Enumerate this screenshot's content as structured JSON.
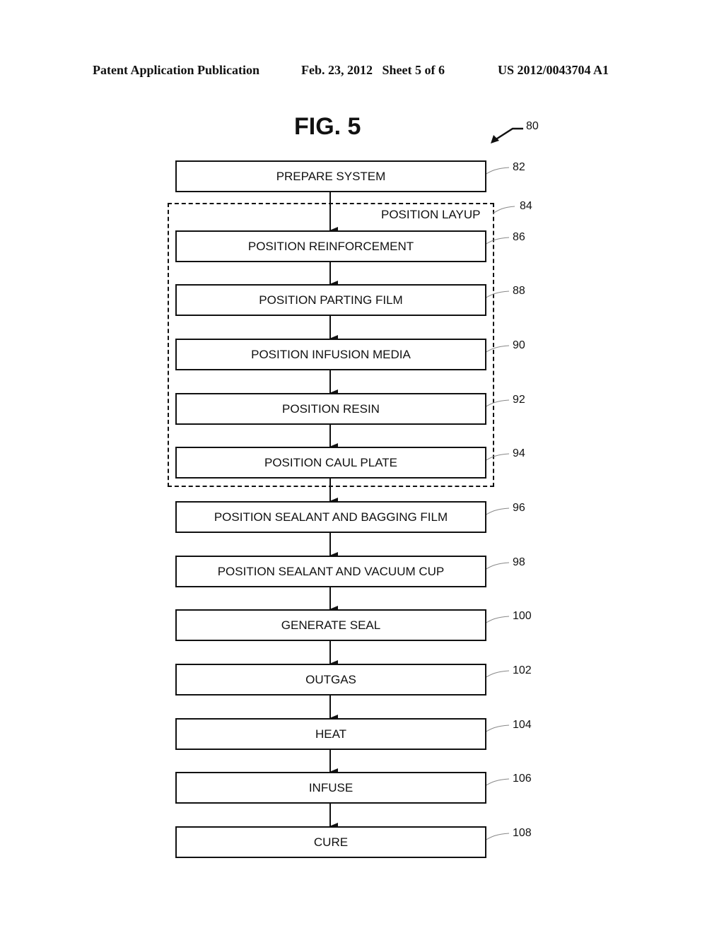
{
  "header": {
    "publication": "Patent Application Publication",
    "date_sheet": "Feb. 23, 2012   Sheet 5 of 6",
    "number": "US 2012/0043704 A1"
  },
  "figure": {
    "title": "FIG. 5",
    "ref": "80",
    "group": {
      "label": "POSITION LAYUP",
      "ref": "84"
    },
    "steps": [
      {
        "label": "PREPARE SYSTEM",
        "ref": "82"
      },
      {
        "label": "POSITION REINFORCEMENT",
        "ref": "86"
      },
      {
        "label": "POSITION PARTING FILM",
        "ref": "88"
      },
      {
        "label": "POSITION INFUSION MEDIA",
        "ref": "90"
      },
      {
        "label": "POSITION RESIN",
        "ref": "92"
      },
      {
        "label": "POSITION CAUL PLATE",
        "ref": "94"
      },
      {
        "label": "POSITION SEALANT AND BAGGING FILM",
        "ref": "96"
      },
      {
        "label": "POSITION SEALANT AND VACUUM CUP",
        "ref": "98"
      },
      {
        "label": "GENERATE SEAL",
        "ref": "100"
      },
      {
        "label": "OUTGAS",
        "ref": "102"
      },
      {
        "label": "HEAT",
        "ref": "104"
      },
      {
        "label": "INFUSE",
        "ref": "106"
      },
      {
        "label": "CURE",
        "ref": "108"
      }
    ]
  }
}
